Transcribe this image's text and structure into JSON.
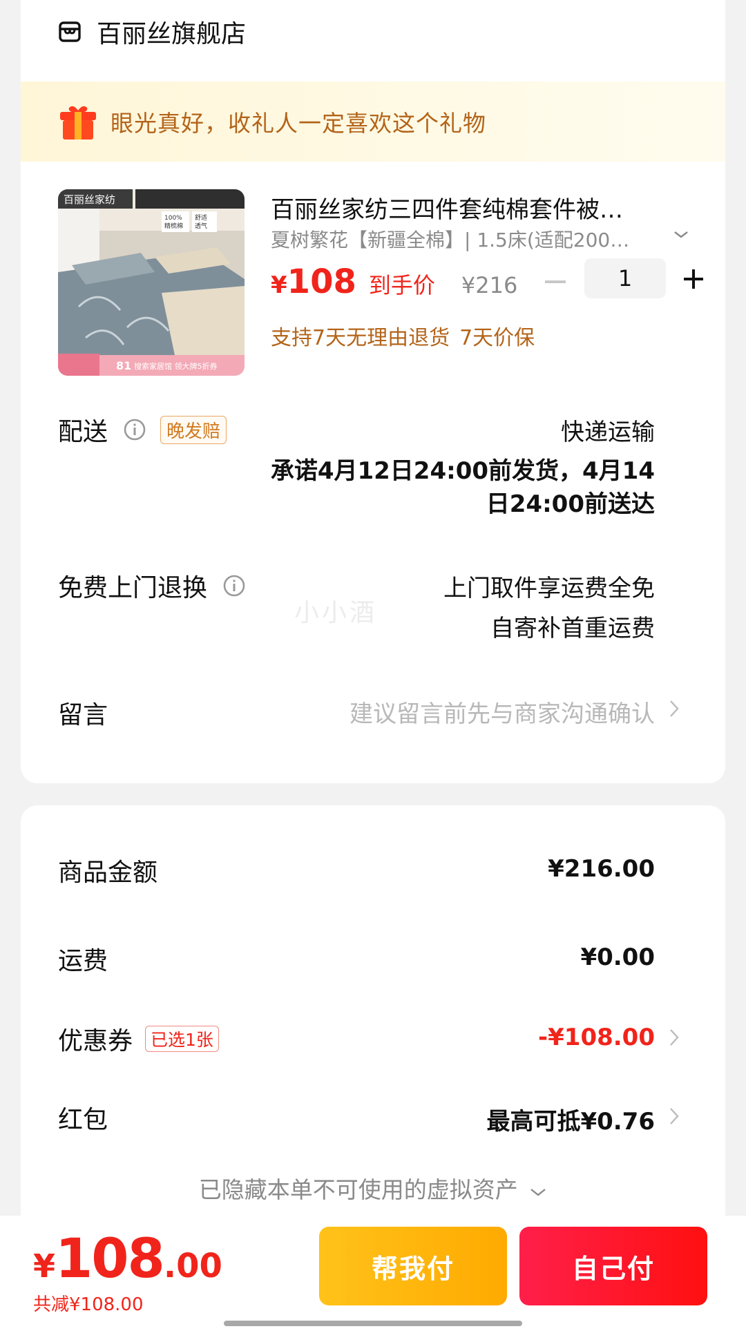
{
  "store": {
    "name": "百丽丝旗舰店",
    "icon": "store-icon"
  },
  "gift_banner": {
    "text": "眼光真好，收礼人一定喜欢这个礼物",
    "icon": "gift-icon"
  },
  "product": {
    "title": "百丽丝家纺三四件套纯棉套件被…",
    "sku": "夏树繁花【新疆全棉】| 1.5床(适配200…",
    "price_currency": "¥",
    "price": "108",
    "price_tag": "到手价",
    "original_price": "¥216",
    "quantity": "1",
    "guarantees": [
      "支持7天无理由退货",
      "7天价保"
    ],
    "image_texts": {
      "brand": "百丽丝家纺",
      "badge_1": "100%",
      "badge_2": "精梳棉",
      "badge_3": "舒适",
      "badge_4": "透气",
      "footer": "搜索家居馆 领大牌5折券",
      "footer_num": "81"
    }
  },
  "delivery": {
    "label": "配送",
    "badge": "晚发赔",
    "method": "快递运输",
    "promise_line1": "承诺4月12日24:00前发货，4月14",
    "promise_line2": "日24:00前送达"
  },
  "returns": {
    "label": "免费上门退换",
    "line1": "上门取件享运费全免",
    "line2": "自寄补首重运费"
  },
  "message": {
    "label": "留言",
    "placeholder": "建议留言前先与商家沟通确认"
  },
  "watermark": "小小酒",
  "summary": {
    "goods_label": "商品金额",
    "goods_amount": "¥216.00",
    "shipping_label": "运费",
    "shipping_amount": "¥0.00",
    "coupon_label": "优惠券",
    "coupon_badge": "已选1张",
    "coupon_amount": "-¥108.00",
    "redpacket_label": "红包",
    "redpacket_amount": "最高可抵¥0.76",
    "hidden_assets": "已隐藏本单不可使用的虚拟资产"
  },
  "footer": {
    "total_currency": "¥",
    "total_int": "108",
    "total_dec": ".00",
    "saved": "共减¥108.00",
    "help_pay": "帮我付",
    "self_pay": "自己付"
  },
  "colors": {
    "accent_red": "#f0241b",
    "banner_text": "#b3641a",
    "help_button": "#ffb400",
    "self_button": "#ff1535"
  }
}
